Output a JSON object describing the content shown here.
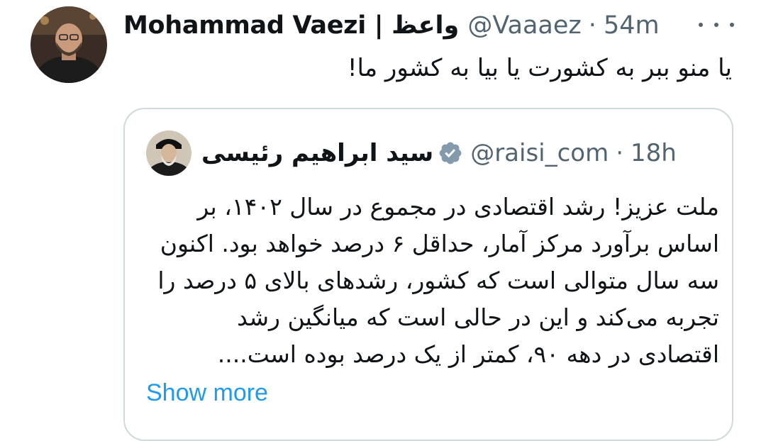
{
  "tweet": {
    "author_name": "Mohammad Vaezi | واعظ",
    "handle": "@Vaaaez",
    "separator": "·",
    "time": "54m",
    "text": "یا منو ببر به کشورت یا بیا به کشور ما!"
  },
  "quoted": {
    "author_name": "سید ابراهیم رئیسی",
    "handle": "@raisi_com",
    "separator": "·",
    "time": "18h",
    "lines": [
      "ملت عزیز! رشد اقتصادی در مجموع در سال ۱۴۰۲، بر",
      "اساس برآورد مرکز آمار، حداقل ۶ درصد خواهد بود. اکنون",
      "سه سال متوالی است که کشور، رشدهای بالای ۵ درصد را",
      "تجربه می‌کند و این در حالی است که میانگین رشد",
      "اقتصادی در دهه ۹۰، کمتر از یک درصد بوده است...."
    ],
    "show_more_label": "Show more"
  },
  "icons": {
    "more": "more-horizontal-icon",
    "verified": "verified-badge-icon"
  },
  "colors": {
    "text_primary": "#0f1419",
    "text_secondary": "#536471",
    "link": "#1d9bf0",
    "border": "#cfd9de",
    "verified_badge": "#829aab"
  }
}
